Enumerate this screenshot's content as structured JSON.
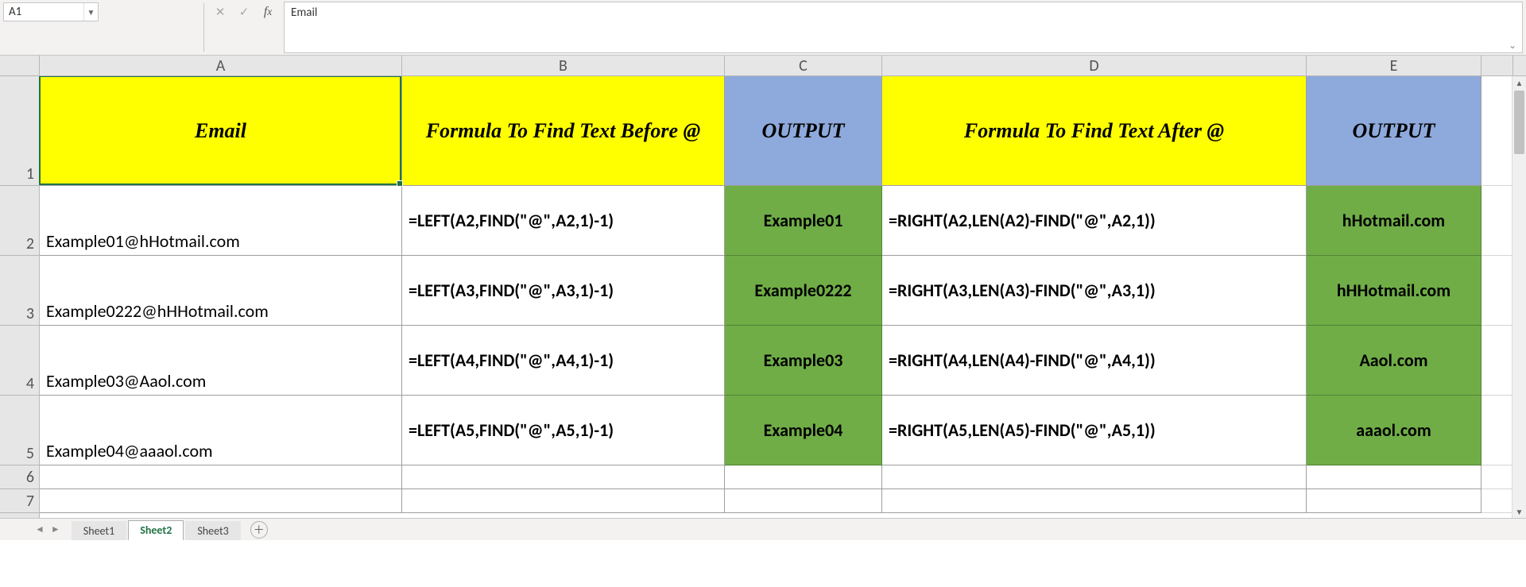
{
  "namebox": "A1",
  "formula_bar_value": "Email",
  "columns": [
    "A",
    "B",
    "C",
    "D",
    "E"
  ],
  "row_headers": [
    "1",
    "2",
    "3",
    "4",
    "5",
    "6",
    "7"
  ],
  "header_row": {
    "A": "Email",
    "B": "Formula To Find Text Before @",
    "C": "OUTPUT",
    "D": "Formula To Find Text After @",
    "E": "OUTPUT"
  },
  "data_rows": [
    {
      "A": "Example01@hHotmail.com",
      "B": "=LEFT(A2,FIND(\"@\",A2,1)-1)",
      "C": "Example01",
      "D": "=RIGHT(A2,LEN(A2)-FIND(\"@\",A2,1))",
      "E": "hHotmail.com"
    },
    {
      "A": "Example0222@hHHotmail.com",
      "B": "=LEFT(A3,FIND(\"@\",A3,1)-1)",
      "C": "Example0222",
      "D": "=RIGHT(A3,LEN(A3)-FIND(\"@\",A3,1))",
      "E": "hHHotmail.com"
    },
    {
      "A": "Example03@Aaol.com",
      "B": "=LEFT(A4,FIND(\"@\",A4,1)-1)",
      "C": "Example03",
      "D": "=RIGHT(A4,LEN(A4)-FIND(\"@\",A4,1))",
      "E": "Aaol.com"
    },
    {
      "A": "Example04@aaaol.com",
      "B": "=LEFT(A5,FIND(\"@\",A5,1)-1)",
      "C": "Example04",
      "D": "=RIGHT(A5,LEN(A5)-FIND(\"@\",A5,1))",
      "E": "aaaol.com"
    }
  ],
  "sheet_tabs": [
    "Sheet1",
    "Sheet2",
    "Sheet3"
  ],
  "active_tab": "Sheet2",
  "active_cell": "A1"
}
